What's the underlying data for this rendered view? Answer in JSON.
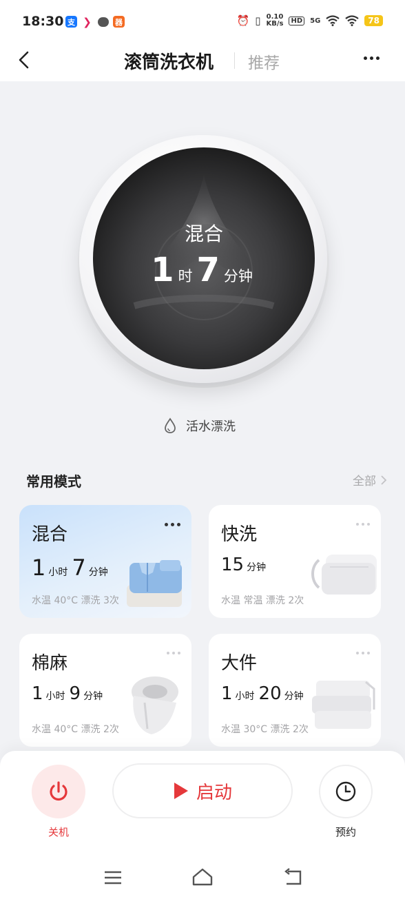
{
  "status_bar": {
    "time": "18:30",
    "app_icons": [
      "alipay-icon",
      "arrow-app-icon",
      "chat-icon",
      "orange-app-icon"
    ],
    "alipay_glyph": "支",
    "orange_glyph": "器",
    "network_speed_value": "0.10",
    "network_speed_unit": "KB/s",
    "hd_label": "HD",
    "signal_label": "5G",
    "battery": "78"
  },
  "header": {
    "title": "滚筒洗衣机",
    "tab": "推荐"
  },
  "drum": {
    "mode": "混合",
    "hours": "1",
    "hours_unit": "时",
    "minutes": "7",
    "minutes_unit": "分钟"
  },
  "feature": {
    "icon": "water-drop-icon",
    "label": "活水漂洗"
  },
  "section": {
    "title": "常用模式",
    "all_link": "全部"
  },
  "cards": [
    {
      "name": "混合",
      "time_parts": [
        [
          "1",
          "小时"
        ],
        [
          "7",
          "分钟"
        ]
      ],
      "meta": "水温 40°C 漂洗 3次",
      "active": true,
      "art": "shirt"
    },
    {
      "name": "快洗",
      "time_parts": [
        [
          "15",
          "分钟"
        ]
      ],
      "meta": "水温 常温 漂洗 2次",
      "active": false,
      "art": "folded"
    },
    {
      "name": "棉麻",
      "time_parts": [
        [
          "1",
          "小时"
        ],
        [
          "9",
          "分钟"
        ]
      ],
      "meta": "水温 40°C 漂洗 2次",
      "active": false,
      "art": "scarf"
    },
    {
      "name": "大件",
      "time_parts": [
        [
          "1",
          "小时"
        ],
        [
          "20",
          "分钟"
        ]
      ],
      "meta": "水温 30°C 漂洗 2次",
      "active": false,
      "art": "bedding"
    }
  ],
  "controls": {
    "power_label": "关机",
    "start_label": "启动",
    "schedule_label": "预约"
  },
  "colors": {
    "accent": "#e5383b",
    "active_card": "#c9e1fb",
    "background": "#f1f2f5"
  }
}
